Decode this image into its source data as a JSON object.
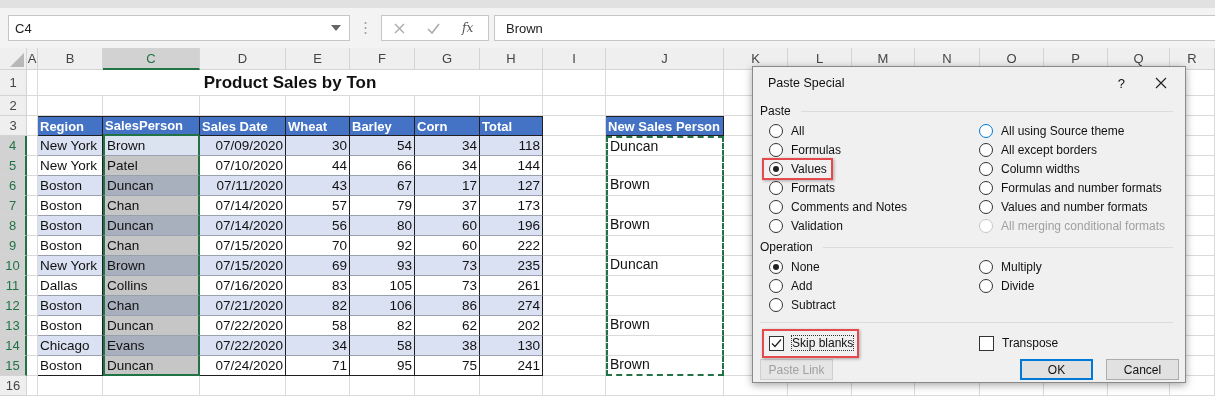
{
  "formula_bar": {
    "name_box": "C4",
    "function_label": "fx",
    "value": "Brown"
  },
  "sheet": {
    "column_headers": [
      {
        "label": "A",
        "selected": false
      },
      {
        "label": "B",
        "selected": false
      },
      {
        "label": "C",
        "selected": true
      },
      {
        "label": "D",
        "selected": false
      },
      {
        "label": "E",
        "selected": false
      },
      {
        "label": "F",
        "selected": false
      },
      {
        "label": "G",
        "selected": false
      },
      {
        "label": "H",
        "selected": false
      },
      {
        "label": "I",
        "selected": false
      },
      {
        "label": "J",
        "selected": false
      },
      {
        "label": "K",
        "selected": false
      },
      {
        "label": "L",
        "selected": false
      },
      {
        "label": "M",
        "selected": false
      },
      {
        "label": "N",
        "selected": false
      },
      {
        "label": "O",
        "selected": false
      },
      {
        "label": "P",
        "selected": false
      },
      {
        "label": "Q",
        "selected": false
      },
      {
        "label": "R",
        "selected": false
      }
    ],
    "row_headers": [
      {
        "label": "1",
        "selected": false
      },
      {
        "label": "2",
        "selected": false
      },
      {
        "label": "3",
        "selected": false
      },
      {
        "label": "4",
        "selected": true
      },
      {
        "label": "5",
        "selected": true
      },
      {
        "label": "6",
        "selected": true
      },
      {
        "label": "7",
        "selected": true
      },
      {
        "label": "8",
        "selected": true
      },
      {
        "label": "9",
        "selected": true
      },
      {
        "label": "10",
        "selected": true
      },
      {
        "label": "11",
        "selected": true
      },
      {
        "label": "12",
        "selected": true
      },
      {
        "label": "13",
        "selected": true
      },
      {
        "label": "14",
        "selected": true
      },
      {
        "label": "15",
        "selected": true
      },
      {
        "label": "16",
        "selected": false
      }
    ],
    "title": "Product Sales by Ton",
    "table": {
      "columns": [
        {
          "label": "Region",
          "kind": "text",
          "selected": false
        },
        {
          "label": "SalesPerson",
          "kind": "text",
          "selected": true
        },
        {
          "label": "Sales Date",
          "kind": "date",
          "selected": false
        },
        {
          "label": "Wheat",
          "kind": "number",
          "selected": false
        },
        {
          "label": "Barley",
          "kind": "number",
          "selected": false
        },
        {
          "label": "Corn",
          "kind": "number",
          "selected": false
        },
        {
          "label": "Total",
          "kind": "number",
          "selected": false
        }
      ],
      "rows": [
        {
          "banded": true,
          "cells": [
            "New York",
            "Brown",
            "07/09/2020",
            "30",
            "54",
            "34",
            "118"
          ]
        },
        {
          "banded": false,
          "cells": [
            "New York",
            "Patel",
            "07/10/2020",
            "44",
            "66",
            "34",
            "144"
          ]
        },
        {
          "banded": true,
          "cells": [
            "Boston",
            "Duncan",
            "07/11/2020",
            "43",
            "67",
            "17",
            "127"
          ]
        },
        {
          "banded": false,
          "cells": [
            "Boston",
            "Chan",
            "07/14/2020",
            "57",
            "79",
            "37",
            "173"
          ]
        },
        {
          "banded": true,
          "cells": [
            "Boston",
            "Duncan",
            "07/14/2020",
            "56",
            "80",
            "60",
            "196"
          ]
        },
        {
          "banded": false,
          "cells": [
            "Boston",
            "Chan",
            "07/15/2020",
            "70",
            "92",
            "60",
            "222"
          ]
        },
        {
          "banded": true,
          "cells": [
            "New York",
            "Brown",
            "07/15/2020",
            "69",
            "93",
            "73",
            "235"
          ]
        },
        {
          "banded": false,
          "cells": [
            "Dallas",
            "Collins",
            "07/16/2020",
            "83",
            "105",
            "73",
            "261"
          ]
        },
        {
          "banded": true,
          "cells": [
            "Boston",
            "Chan",
            "07/21/2020",
            "82",
            "106",
            "86",
            "274"
          ]
        },
        {
          "banded": false,
          "cells": [
            "Boston",
            "Duncan",
            "07/22/2020",
            "58",
            "82",
            "62",
            "202"
          ]
        },
        {
          "banded": true,
          "cells": [
            "Chicago",
            "Evans",
            "07/22/2020",
            "34",
            "58",
            "38",
            "130"
          ]
        },
        {
          "banded": false,
          "cells": [
            "Boston",
            "Duncan",
            "07/24/2020",
            "71",
            "95",
            "75",
            "241"
          ]
        }
      ]
    },
    "new_column": {
      "header": "New Sales Person",
      "copied": true,
      "cells": [
        {
          "text": "Duncan"
        },
        {},
        {
          "text": "Brown"
        },
        {},
        {
          "text": "Brown"
        },
        {},
        {
          "text": "Duncan"
        },
        {},
        {},
        {
          "text": "Brown"
        },
        {},
        {
          "text": "Brown"
        }
      ]
    }
  },
  "dialog": {
    "title": "Paste Special",
    "help": "?",
    "paste": {
      "label": "Paste",
      "columns": [
        [
          {
            "label": "All",
            "selected": false
          },
          {
            "label": "Formulas",
            "selected": false
          },
          {
            "label": "Values",
            "selected": true,
            "highlighted": true
          },
          {
            "label": "Formats",
            "selected": false
          },
          {
            "label": "Comments and Notes",
            "selected": false
          },
          {
            "label": "Validation",
            "selected": false
          }
        ],
        [
          {
            "label": "All using Source theme",
            "selected": false,
            "hover": true
          },
          {
            "label": "All except borders",
            "selected": false
          },
          {
            "label": "Column widths",
            "selected": false
          },
          {
            "label": "Formulas and number formats",
            "selected": false
          },
          {
            "label": "Values and number formats",
            "selected": false
          },
          {
            "label": "All merging conditional formats",
            "selected": false,
            "disabled": true
          }
        ]
      ]
    },
    "operation": {
      "label": "Operation",
      "columns": [
        [
          {
            "label": "None",
            "selected": true
          },
          {
            "label": "Add",
            "selected": false
          },
          {
            "label": "Subtract",
            "selected": false
          }
        ],
        [
          {
            "label": "Multiply",
            "selected": false
          },
          {
            "label": "Divide",
            "selected": false
          }
        ]
      ]
    },
    "checkboxes": [
      {
        "label": "Skip blanks",
        "checked": true,
        "highlighted": true
      },
      {
        "label": "Transpose",
        "checked": false
      }
    ],
    "buttons": [
      {
        "label": "Paste Link",
        "disabled": true
      },
      {
        "label": "OK",
        "default": true
      },
      {
        "label": "Cancel"
      }
    ]
  }
}
